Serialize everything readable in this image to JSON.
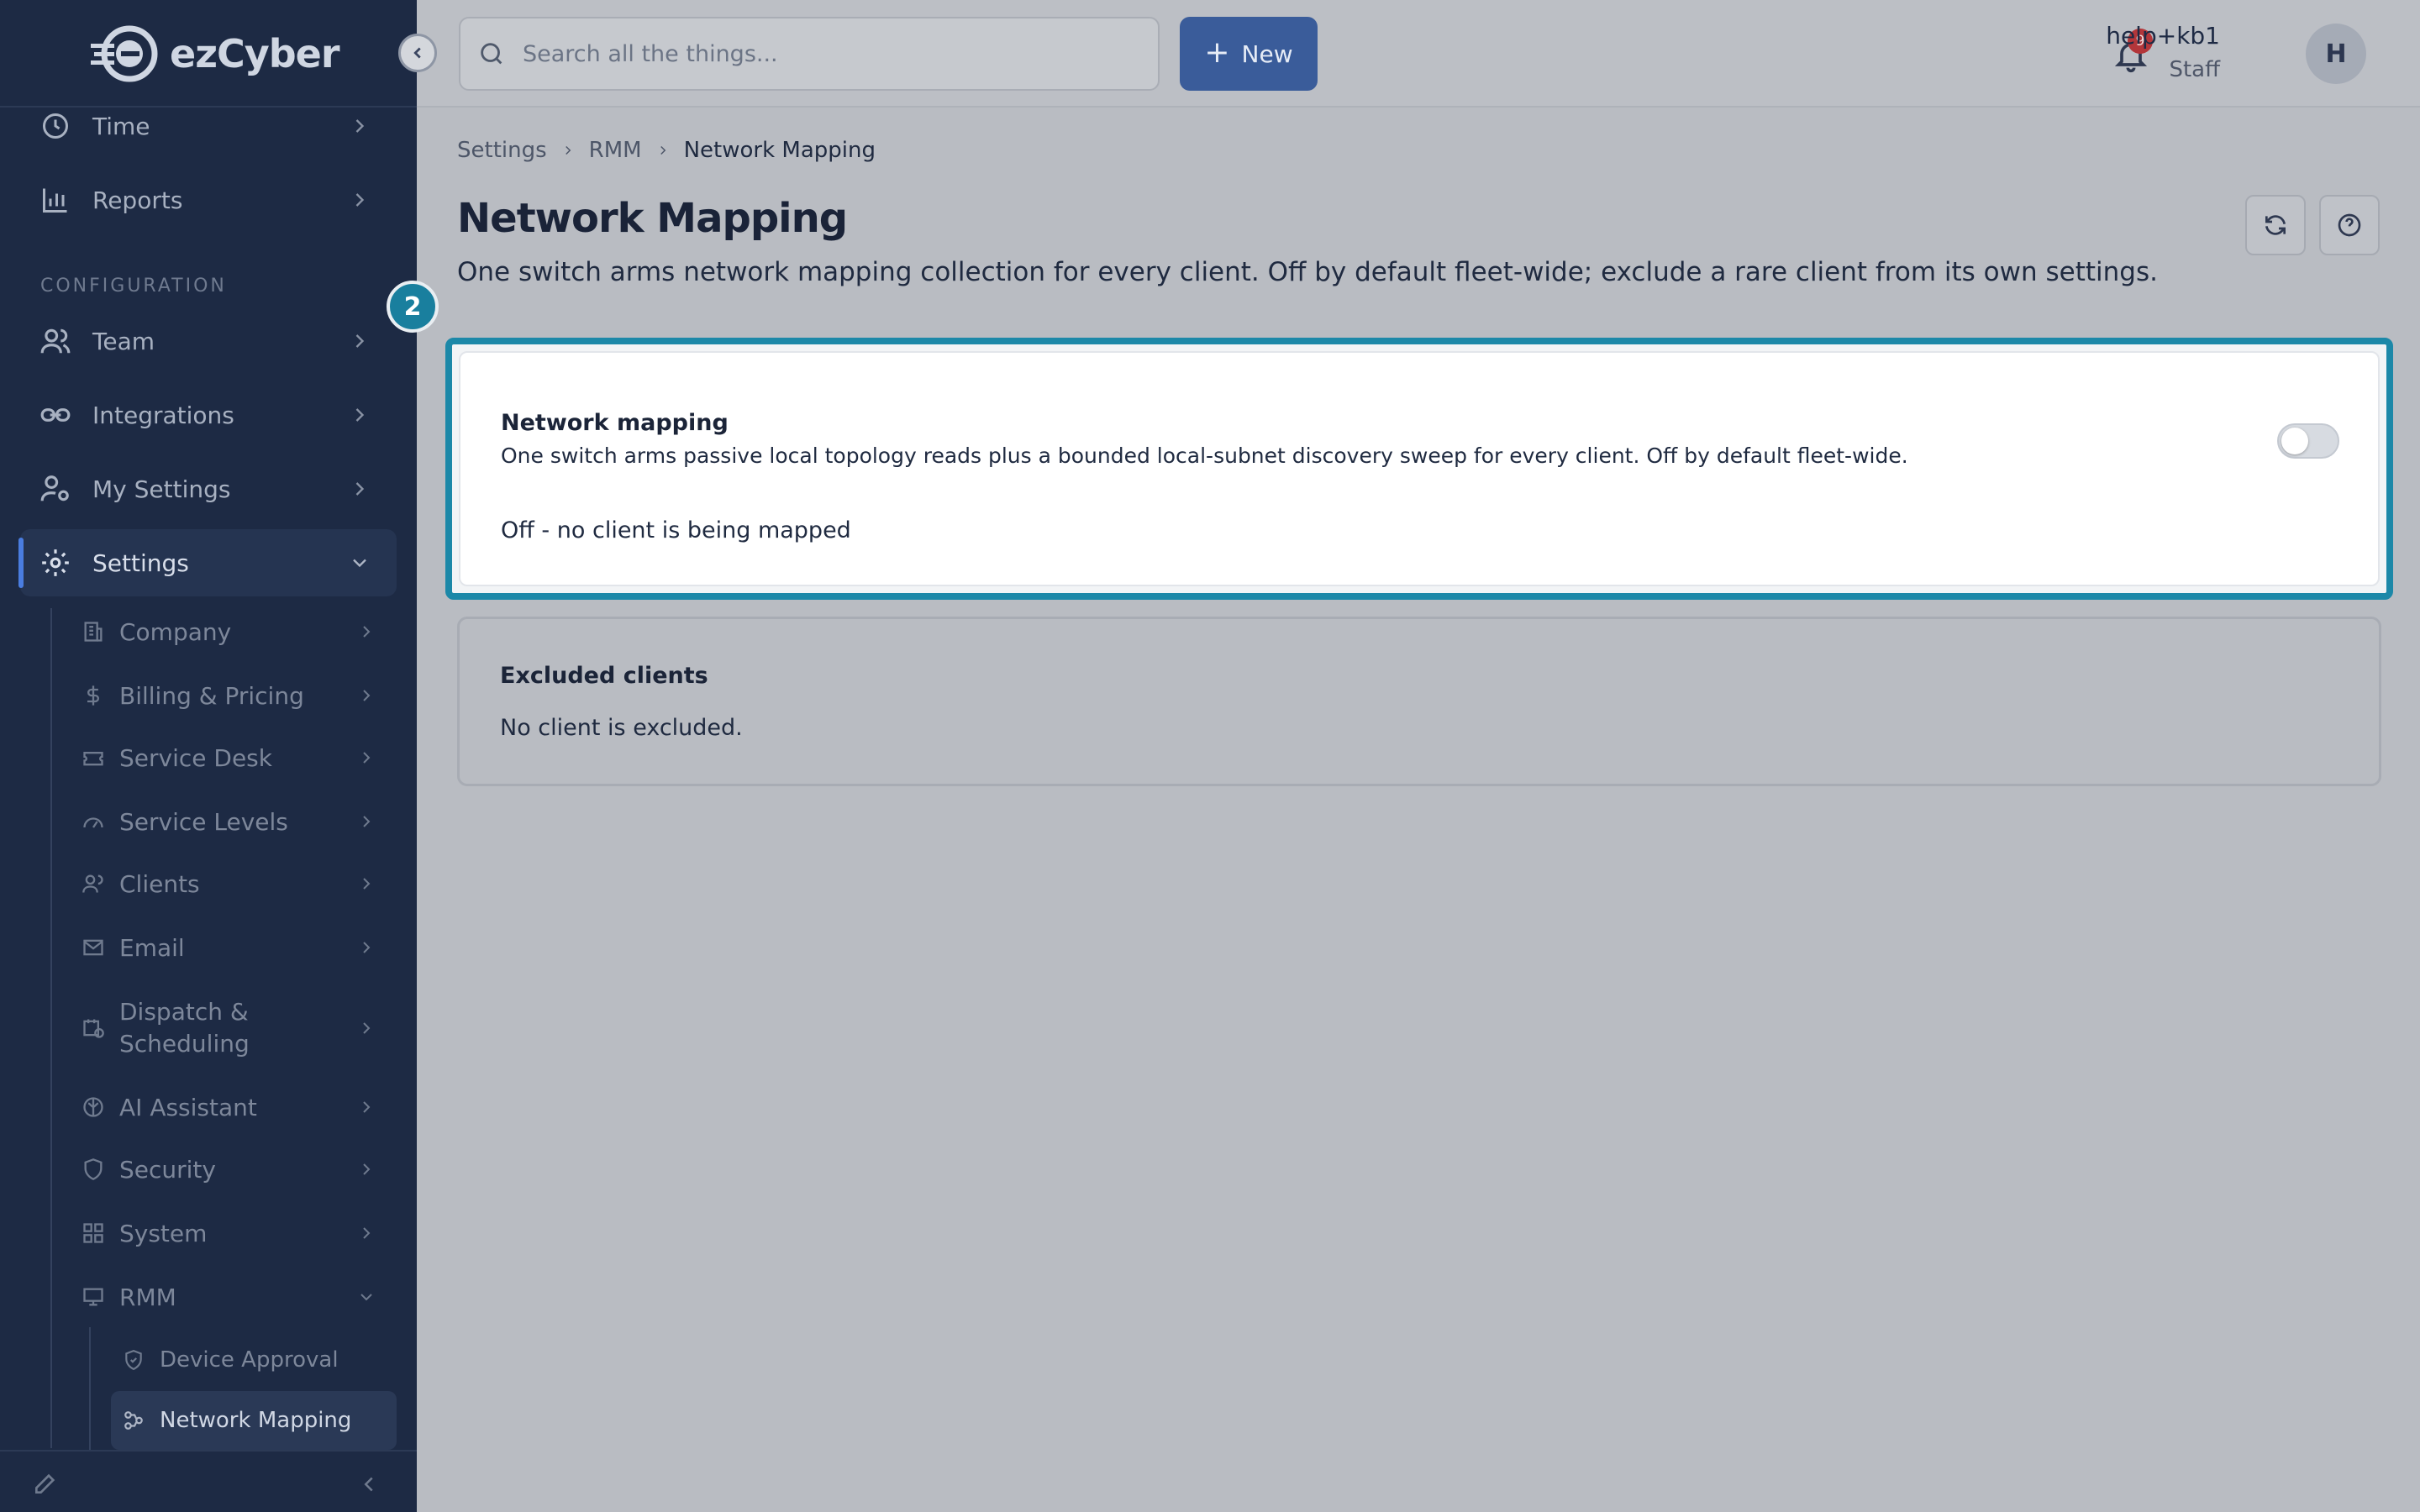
{
  "brand": {
    "name": "ezCyber"
  },
  "sidebar": {
    "nav_top": [
      {
        "label": "Time",
        "icon": "clock-icon"
      },
      {
        "label": "Reports",
        "icon": "bar-chart-icon"
      }
    ],
    "section_label": "CONFIGURATION",
    "nav_config": [
      {
        "label": "Team",
        "icon": "users-icon"
      },
      {
        "label": "Integrations",
        "icon": "link-icon"
      },
      {
        "label": "My Settings",
        "icon": "user-gear-icon"
      },
      {
        "label": "Settings",
        "icon": "gear-icon",
        "active": true
      }
    ],
    "settings_children": [
      {
        "label": "Company",
        "icon": "building-icon"
      },
      {
        "label": "Billing & Pricing",
        "icon": "dollar-icon"
      },
      {
        "label": "Service Desk",
        "icon": "ticket-icon"
      },
      {
        "label": "Service Levels",
        "icon": "gauge-icon"
      },
      {
        "label": "Clients",
        "icon": "clients-icon"
      },
      {
        "label": "Email",
        "icon": "mail-icon"
      },
      {
        "label": "Dispatch & Scheduling",
        "icon": "calendar-clock-icon"
      },
      {
        "label": "AI Assistant",
        "icon": "brain-icon"
      },
      {
        "label": "Security",
        "icon": "shield-icon"
      },
      {
        "label": "System",
        "icon": "grid-icon"
      },
      {
        "label": "RMM",
        "icon": "monitor-icon"
      }
    ],
    "rmm_children": [
      {
        "label": "Device Approval",
        "icon": "shield-check-icon"
      },
      {
        "label": "Network Mapping",
        "icon": "network-icon",
        "active": true
      }
    ]
  },
  "topbar": {
    "search_placeholder": "Search all the things...",
    "new_label": "New",
    "notification_count": "9",
    "user_name": "help+kb1",
    "user_role": "Staff",
    "avatar_initial": "H"
  },
  "breadcrumb": [
    "Settings",
    "RMM",
    "Network Mapping"
  ],
  "page": {
    "title": "Network Mapping",
    "description": "One switch arms network mapping collection for every client. Off by default fleet-wide; exclude a rare client from its own settings."
  },
  "tour_step": "2",
  "network_card": {
    "title": "Network mapping",
    "description": "One switch arms passive local topology reads plus a bounded local-subnet discovery sweep for every client. Off by default fleet-wide.",
    "status": "Off - no client is being mapped",
    "toggle_on": false
  },
  "excluded_card": {
    "title": "Excluded clients",
    "text": "No client is excluded."
  },
  "colors": {
    "sidebar_bg": "#1d2a44",
    "accent": "#3a5c9a",
    "highlight": "#1c88a8",
    "badge": "#b3363a"
  }
}
